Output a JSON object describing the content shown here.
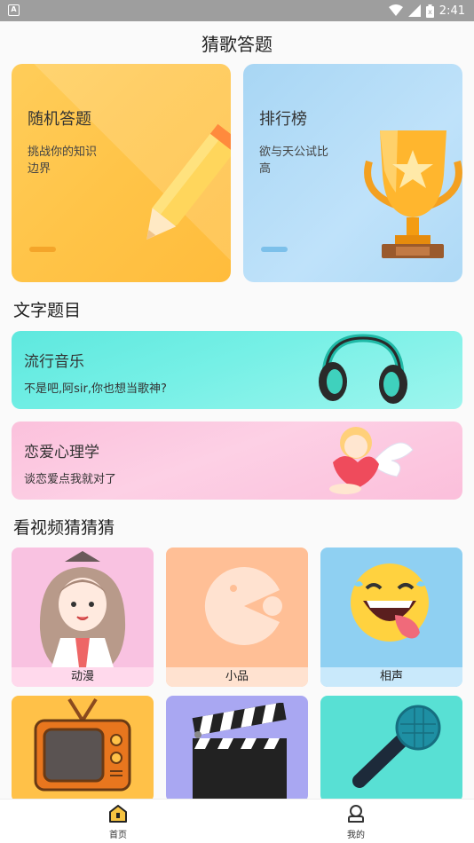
{
  "statusbar": {
    "time": "2:41",
    "app_icon": "A",
    "icons": [
      "wifi-icon",
      "signal-icon",
      "battery-icon"
    ]
  },
  "header": {
    "title": "猜歌答题"
  },
  "top_cards": [
    {
      "title": "随机答题",
      "desc": "挑战你的知识边界",
      "icon": "pencil-icon",
      "color": "#ffc448"
    },
    {
      "title": "排行榜",
      "desc": "欲与天公试比高",
      "icon": "trophy-icon",
      "color": "#b3dcf7"
    }
  ],
  "text_section": {
    "title": "文字题目",
    "banners": [
      {
        "title": "流行音乐",
        "desc": "不是吧,阿sir,你也想当歌神?",
        "icon": "headphones-icon"
      },
      {
        "title": "恋爱心理学",
        "desc": "谈恋爱点我就对了",
        "icon": "cupid-icon"
      }
    ]
  },
  "video_section": {
    "title": "看视频猜猜猜",
    "tiles": [
      {
        "label": "动漫",
        "icon": "anime-girl-icon",
        "color": "#f9bfe0"
      },
      {
        "label": "小品",
        "icon": "pacman-icon",
        "color": "#ffbf96"
      },
      {
        "label": "相声",
        "icon": "laughing-emoji-icon",
        "color": "#8fd0f2"
      },
      {
        "label": "",
        "icon": "tv-icon",
        "color": "#ffc148"
      },
      {
        "label": "",
        "icon": "clapperboard-icon",
        "color": "#a9a7f2"
      },
      {
        "label": "",
        "icon": "microphone-icon",
        "color": "#58e0d4"
      }
    ]
  },
  "navbar": {
    "items": [
      {
        "label": "首页",
        "icon": "home-icon",
        "active": true
      },
      {
        "label": "我的",
        "icon": "profile-icon",
        "active": false
      }
    ]
  }
}
